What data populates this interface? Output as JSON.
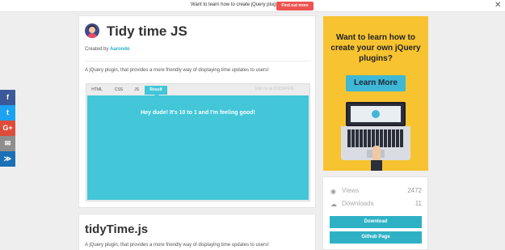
{
  "topbar": {
    "text": "Want to learn how to create jQuery plugins?",
    "button": "Find out more",
    "close": "✕"
  },
  "social": [
    {
      "name": "facebook",
      "glyph": "f"
    },
    {
      "name": "twitter",
      "glyph": "t"
    },
    {
      "name": "google-plus",
      "glyph": "G+"
    },
    {
      "name": "email",
      "glyph": "✉"
    },
    {
      "name": "share",
      "glyph": "≫"
    }
  ],
  "plugin": {
    "title": "Tidy time JS",
    "created_by": "Created by",
    "author": "Aarondo",
    "description": "A jQuery plugin, that provides a more friendly way of displaying time updates to users!"
  },
  "demo": {
    "tabs": [
      "HTML",
      "CSS",
      "JS",
      "Result"
    ],
    "active_tab": "Result",
    "edit_label": "Edit on ⊕ CODEPEN",
    "result_text": "Hey dude! It's 10 to 1 and I'm feeling good!",
    "result_color": "#42c6d8"
  },
  "section2": {
    "title": "tidyTime.js",
    "description": "A jQuery plugin, that provides a more friendly way of displaying time updates to users!"
  },
  "ad": {
    "headline": "Want to learn how to create your own jQuery plugins?",
    "cta": "Learn More",
    "background": "#f7c331"
  },
  "stats": {
    "views_label": "Views",
    "views_value": "2472",
    "views_icon": "eye-icon",
    "downloads_label": "Downloads",
    "downloads_value": "11",
    "downloads_icon": "cloud-download-icon"
  },
  "actions": {
    "download": "Download",
    "github": "Github Page",
    "accent": "#2fb1c5"
  }
}
